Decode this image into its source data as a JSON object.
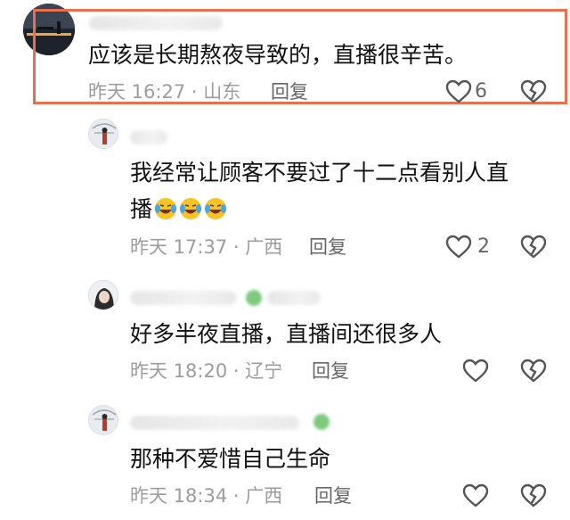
{
  "comments": [
    {
      "text": "应该是长期熬夜导致的，直播很辛苦。",
      "meta": "昨天 16:27 · 山东",
      "reply_label": "回复",
      "likes": "6",
      "avatar_icon": "night-harbor-avatar-icon"
    },
    {
      "text_line1": "我经常让顾客不要过了十二点看别人直",
      "text_line2": "播",
      "emoji_count": 3,
      "emoji_icon": "laughing-crying-emoji-icon",
      "meta": "昨天 17:37 · 广西",
      "reply_label": "回复",
      "likes": "2",
      "avatar_icon": "girl-avatar-icon"
    },
    {
      "text": "好多半夜直播，直播间还很多人",
      "meta": "昨天 18:20 · 辽宁",
      "reply_label": "回复",
      "avatar_icon": "dark-hair-avatar-icon"
    },
    {
      "text": "那种不爱惜自己生命",
      "meta": "昨天 18:34 · 广西",
      "reply_label": "回复",
      "avatar_icon": "girl-avatar-icon"
    }
  ],
  "colors": {
    "highlight_border": "#e8704f",
    "meta_gray": "#9c9c9c",
    "icon_gray": "#555555"
  },
  "icons": {
    "like": "heart-icon",
    "dislike": "broken-heart-icon"
  }
}
